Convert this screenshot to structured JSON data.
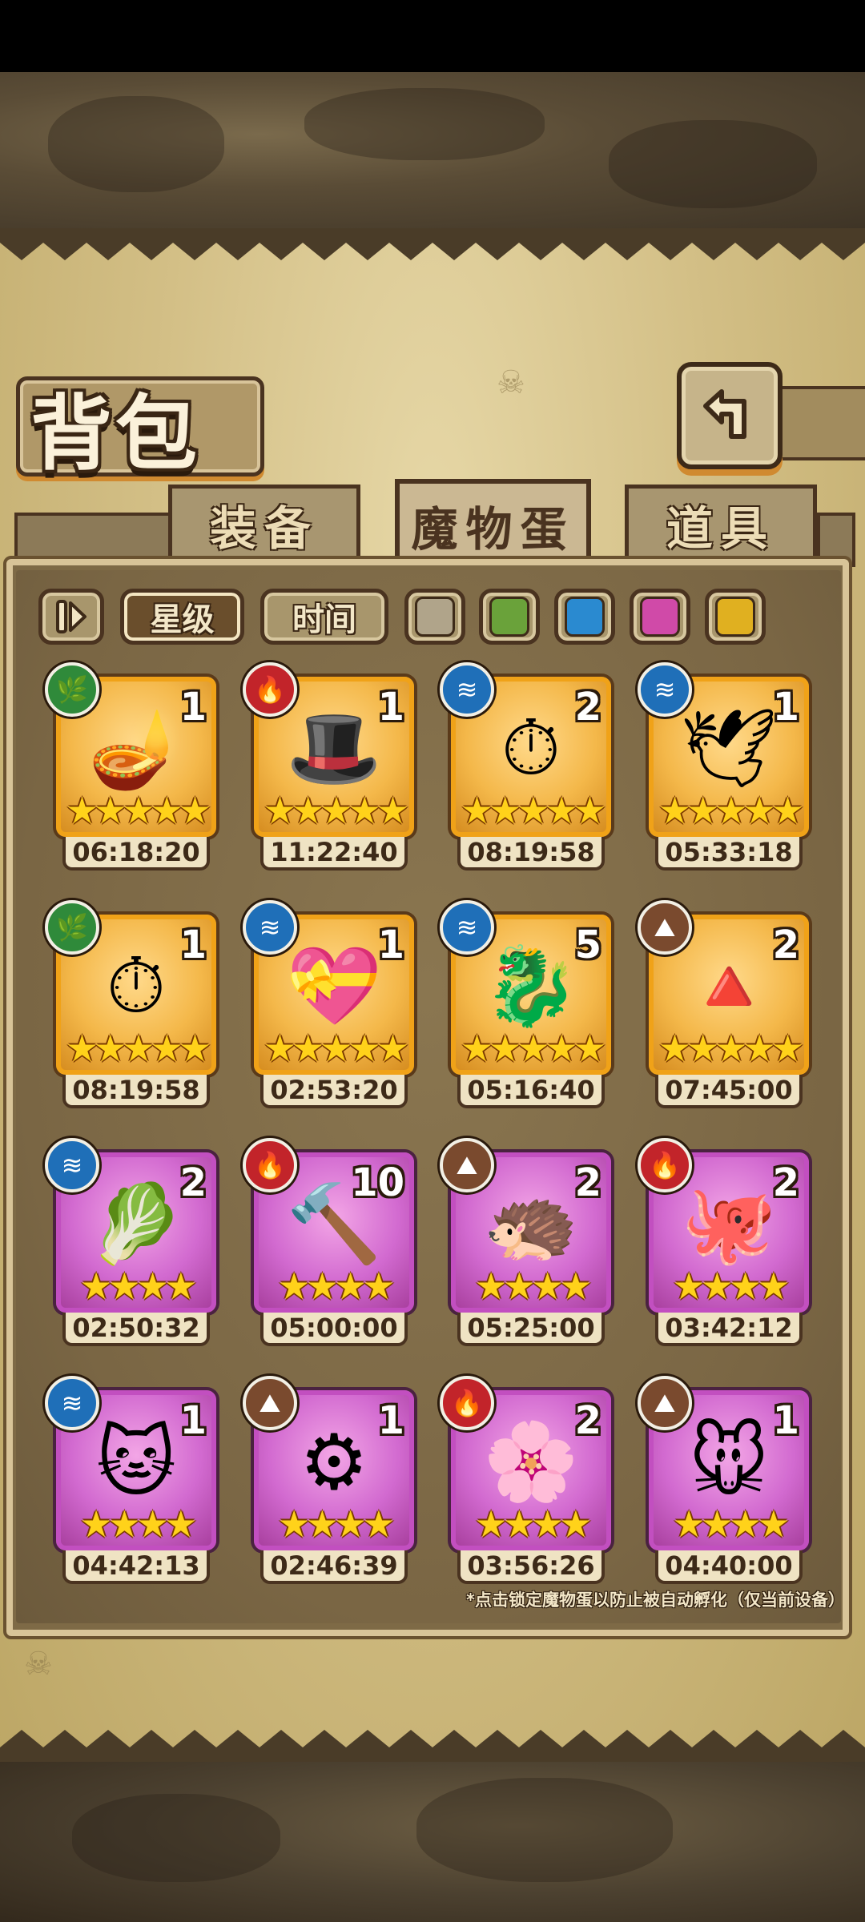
{
  "header": {
    "title": "背包",
    "back_icon": "return-arrow-icon"
  },
  "tabs": [
    {
      "label": "装备",
      "active": false
    },
    {
      "label": "魔物蛋",
      "active": true
    },
    {
      "label": "道具",
      "active": false
    }
  ],
  "filters": {
    "sort_toggle_icon": "sort-toggle-icon",
    "star_label": "星级",
    "time_label": "时间",
    "colors": [
      "#b0a48a",
      "#6aa23a",
      "#2a8ad0",
      "#d04aa8",
      "#e0b020"
    ]
  },
  "eggs": [
    {
      "element": "plant",
      "count": "1",
      "stars": 5,
      "rarity": "gold",
      "time": "06:18:20",
      "art": "🪔"
    },
    {
      "element": "fire",
      "count": "1",
      "stars": 5,
      "rarity": "gold",
      "time": "11:22:40",
      "art": "🎩"
    },
    {
      "element": "water",
      "count": "2",
      "stars": 5,
      "rarity": "gold",
      "time": "08:19:58",
      "art": "⏱"
    },
    {
      "element": "water",
      "count": "1",
      "stars": 5,
      "rarity": "gold",
      "time": "05:33:18",
      "art": "🕊"
    },
    {
      "element": "plant",
      "count": "1",
      "stars": 5,
      "rarity": "gold",
      "time": "08:19:58",
      "art": "⏱"
    },
    {
      "element": "water",
      "count": "1",
      "stars": 5,
      "rarity": "gold",
      "time": "02:53:20",
      "art": "💝"
    },
    {
      "element": "water",
      "count": "5",
      "stars": 5,
      "rarity": "gold",
      "time": "05:16:40",
      "art": "🐉"
    },
    {
      "element": "earth",
      "count": "2",
      "stars": 5,
      "rarity": "gold",
      "time": "07:45:00",
      "art": "🔺"
    },
    {
      "element": "water",
      "count": "2",
      "stars": 4,
      "rarity": "purple",
      "time": "02:50:32",
      "art": "🥬"
    },
    {
      "element": "fire",
      "count": "10",
      "stars": 4,
      "rarity": "purple",
      "time": "05:00:00",
      "art": "🔨"
    },
    {
      "element": "earth",
      "count": "2",
      "stars": 4,
      "rarity": "purple",
      "time": "05:25:00",
      "art": "🦔"
    },
    {
      "element": "fire",
      "count": "2",
      "stars": 4,
      "rarity": "purple",
      "time": "03:42:12",
      "art": "🐙"
    },
    {
      "element": "water",
      "count": "1",
      "stars": 4,
      "rarity": "purple",
      "time": "04:42:13",
      "art": "🐱"
    },
    {
      "element": "earth",
      "count": "1",
      "stars": 4,
      "rarity": "purple",
      "time": "02:46:39",
      "art": "⚙"
    },
    {
      "element": "fire",
      "count": "2",
      "stars": 4,
      "rarity": "purple",
      "time": "03:56:26",
      "art": "🌸"
    },
    {
      "element": "earth",
      "count": "1",
      "stars": 4,
      "rarity": "purple",
      "time": "04:40:00",
      "art": "🐭"
    }
  ],
  "hint": "*点击锁定魔物蛋以防止被自动孵化（仅当前设备）",
  "element_icons": {
    "plant": "leaf-icon",
    "fire": "flame-icon",
    "water": "water-wave-icon",
    "earth": "mountain-icon"
  }
}
